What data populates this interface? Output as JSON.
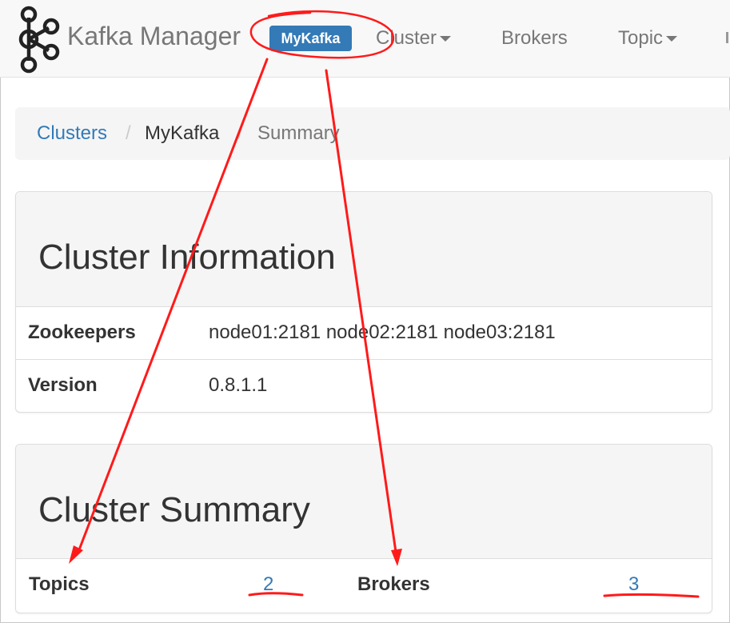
{
  "navbar": {
    "brand": "Kafka Manager",
    "cluster_badge": "MyKafka",
    "items": [
      {
        "label": "Cluster",
        "has_caret": true
      },
      {
        "label": "Brokers",
        "has_caret": false
      },
      {
        "label": "Topic",
        "has_caret": true
      }
    ]
  },
  "breadcrumb": {
    "items": [
      "Clusters",
      "MyKafka",
      "Summary"
    ],
    "separator": "/"
  },
  "cluster_information": {
    "title": "Cluster Information",
    "rows": [
      {
        "label": "Zookeepers",
        "value": "node01:2181 node02:2181 node03:2181"
      },
      {
        "label": "Version",
        "value": "0.8.1.1"
      }
    ]
  },
  "cluster_summary": {
    "title": "Cluster Summary",
    "topics_label": "Topics",
    "topics_value": "2",
    "brokers_label": "Brokers",
    "brokers_value": "3"
  },
  "colors": {
    "accent": "#337ab7",
    "annotation": "#ff1a1a",
    "navbar_bg": "#f8f8f8",
    "panel_heading_bg": "#f5f5f5"
  },
  "icons": {
    "logo": "kafka-logo-icon",
    "caret": "caret-down-icon"
  }
}
